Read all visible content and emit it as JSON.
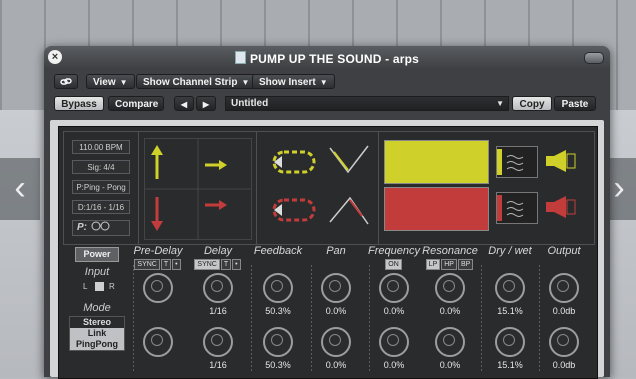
{
  "window": {
    "title": "PUMP UP THE SOUND - arps",
    "close_glyph": "×"
  },
  "toolbar": {
    "link_icon": "link-icon",
    "view_label": "View",
    "show_channel_strip_label": "Show Channel Strip",
    "show_insert_label": "Show Insert",
    "bypass_label": "Bypass",
    "compare_label": "Compare",
    "prev_glyph": "◀",
    "next_glyph": "▶",
    "preset_name": "Untitled",
    "copy_label": "Copy",
    "paste_label": "Paste"
  },
  "info": {
    "bpm": "110.00 BPM",
    "sig": "Sig: 4/4",
    "mode": "P:Ping - Pong",
    "delay": "D:1/16 - 1/16",
    "p_label": "P:"
  },
  "controls": {
    "power_label": "Power",
    "input_label": "Input",
    "input_left": "L",
    "input_right": "R",
    "mode_label": "Mode",
    "modes": [
      "Stereo",
      "Link",
      "PingPong"
    ],
    "params": [
      {
        "name": "Pre-Delay",
        "top": "",
        "bottom": ""
      },
      {
        "name": "Delay",
        "top": "1/16",
        "bottom": "1/16"
      },
      {
        "name": "Feedback",
        "top": "50.3%",
        "bottom": "50.3%"
      },
      {
        "name": "Pan",
        "top": "0.0%",
        "bottom": "0.0%"
      },
      {
        "name": "Frequency",
        "top": "0.0%",
        "bottom": "0.0%"
      },
      {
        "name": "Resonance",
        "top": "0.0%",
        "bottom": "0.0%"
      },
      {
        "name": "Dry / wet",
        "top": "15.1%",
        "bottom": "15.1%"
      },
      {
        "name": "Output",
        "top": "0.0db",
        "bottom": "0.0db"
      }
    ],
    "sync_label": "SYNC",
    "sync_t": "T",
    "sync_dot": "•",
    "on_label": "ON",
    "filters": [
      "LP",
      "HP",
      "BP"
    ]
  },
  "nav": {
    "left_glyph": "‹",
    "right_glyph": "›"
  },
  "colors": {
    "yellow_channel": "#cfd02a",
    "red_channel": "#c33c3c"
  }
}
